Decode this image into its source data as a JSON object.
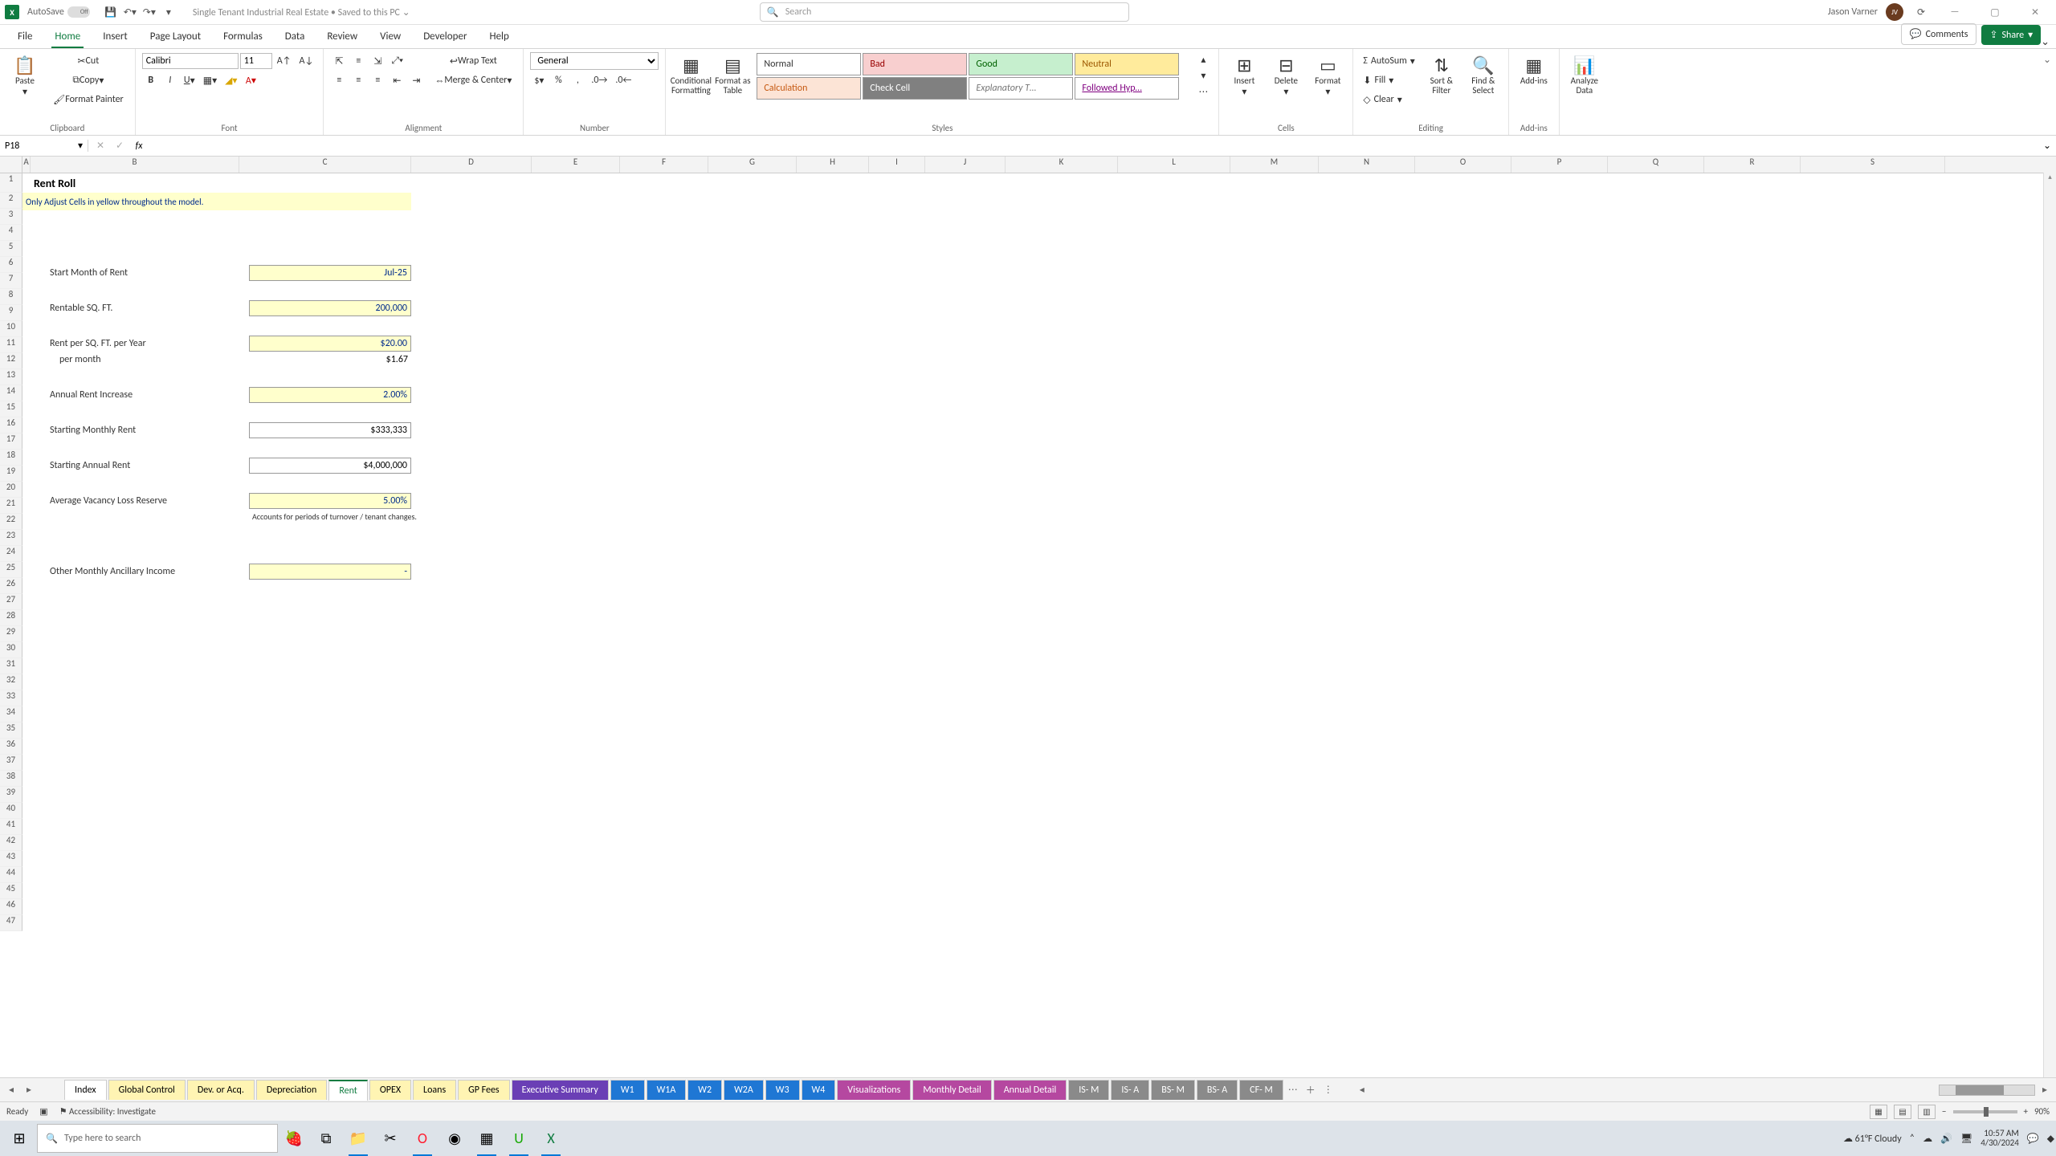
{
  "titlebar": {
    "autosave_label": "AutoSave",
    "autosave_state": "Off",
    "doc_title": "Single Tenant Industrial Real Estate • Saved to this PC ⌄",
    "search_placeholder": "Search",
    "user_name": "Jason Varner",
    "user_initials": "JV"
  },
  "menu_tabs": [
    "File",
    "Home",
    "Insert",
    "Page Layout",
    "Formulas",
    "Data",
    "Review",
    "View",
    "Developer",
    "Help"
  ],
  "comments_label": "Comments",
  "share_label": "Share",
  "ribbon": {
    "clipboard": {
      "paste": "Paste",
      "cut": "Cut",
      "copy": "Copy",
      "format_painter": "Format Painter",
      "label": "Clipboard"
    },
    "font": {
      "name": "Calibri",
      "size": "11",
      "label": "Font"
    },
    "alignment": {
      "wrap": "Wrap Text",
      "merge": "Merge & Center",
      "label": "Alignment"
    },
    "number": {
      "format": "General",
      "label": "Number"
    },
    "styles": {
      "cond": "Conditional Formatting",
      "table": "Format as Table",
      "cells": [
        "Normal",
        "Bad",
        "Good",
        "Neutral",
        "Calculation",
        "Check Cell",
        "Explanatory T…",
        "Followed Hyp…"
      ],
      "label": "Styles"
    },
    "cells_grp": {
      "insert": "Insert",
      "delete": "Delete",
      "format": "Format",
      "label": "Cells"
    },
    "editing": {
      "autosum": "AutoSum",
      "fill": "Fill",
      "clear": "Clear",
      "sort": "Sort & Filter",
      "find": "Find & Select",
      "label": "Editing"
    },
    "addins": {
      "btn": "Add-ins",
      "label": "Add-ins"
    },
    "analyze": {
      "btn": "Analyze Data"
    }
  },
  "formula_bar": {
    "cell_ref": "P18",
    "formula": ""
  },
  "columns": [
    "A",
    "B",
    "C",
    "D",
    "E",
    "F",
    "G",
    "H",
    "I",
    "J",
    "K",
    "L",
    "M",
    "N",
    "O",
    "P",
    "Q",
    "R",
    "S"
  ],
  "rows_visible": 47,
  "sheet": {
    "title": "Rent Roll",
    "note": "Only Adjust Cells in yellow throughout the model.",
    "labels": {
      "start_month": "Start Month of Rent",
      "rentable_sqft": "Rentable SQ. FT.",
      "rent_per_sqft": "Rent per SQ. FT. per Year",
      "per_month": "per month",
      "annual_increase": "Annual Rent Increase",
      "starting_monthly": "Starting Monthly Rent",
      "starting_annual": "Starting Annual Rent",
      "vacancy": "Average Vacancy Loss Reserve",
      "vacancy_note": "Accounts for periods of turnover / tenant changes.",
      "other_income": "Other Monthly Ancillary Income"
    },
    "values": {
      "start_month": "Jul-25",
      "rentable_sqft": "200,000",
      "rent_per_sqft": "$20.00",
      "per_month": "$1.67",
      "annual_increase": "2.00%",
      "starting_monthly": "$333,333",
      "starting_annual": "$4,000,000",
      "vacancy": "5.00%",
      "other_income": "-"
    }
  },
  "sheet_tabs": [
    {
      "name": "Index",
      "color": ""
    },
    {
      "name": "Global Control",
      "color": "#fff4b3"
    },
    {
      "name": "Dev. or Acq.",
      "color": "#fff4b3"
    },
    {
      "name": "Depreciation",
      "color": "#fff4b3"
    },
    {
      "name": "Rent",
      "color": "#fff4b3",
      "active": true
    },
    {
      "name": "OPEX",
      "color": "#fff4b3"
    },
    {
      "name": "Loans",
      "color": "#fff4b3"
    },
    {
      "name": "GP Fees",
      "color": "#fff4b3"
    },
    {
      "name": "Executive Summary",
      "color": "#6a3fb5"
    },
    {
      "name": "W1",
      "color": "#1f77d4"
    },
    {
      "name": "W1A",
      "color": "#1f77d4"
    },
    {
      "name": "W2",
      "color": "#1f77d4"
    },
    {
      "name": "W2A",
      "color": "#1f77d4"
    },
    {
      "name": "W3",
      "color": "#1f77d4"
    },
    {
      "name": "W4",
      "color": "#1f77d4"
    },
    {
      "name": "Visualizations",
      "color": "#b548a0"
    },
    {
      "name": "Monthly Detail",
      "color": "#b548a0"
    },
    {
      "name": "Annual Detail",
      "color": "#b548a0"
    },
    {
      "name": "IS- M",
      "color": "#8a8a8a"
    },
    {
      "name": "IS- A",
      "color": "#8a8a8a"
    },
    {
      "name": "BS- M",
      "color": "#8a8a8a"
    },
    {
      "name": "BS- A",
      "color": "#8a8a8a"
    },
    {
      "name": "CF- M",
      "color": "#8a8a8a"
    }
  ],
  "statusbar": {
    "ready": "Ready",
    "accessibility": "Accessibility: Investigate",
    "zoom": "90%"
  },
  "taskbar": {
    "search_placeholder": "Type here to search",
    "weather": "61°F  Cloudy",
    "time": "10:57 AM",
    "date": "4/30/2024"
  }
}
